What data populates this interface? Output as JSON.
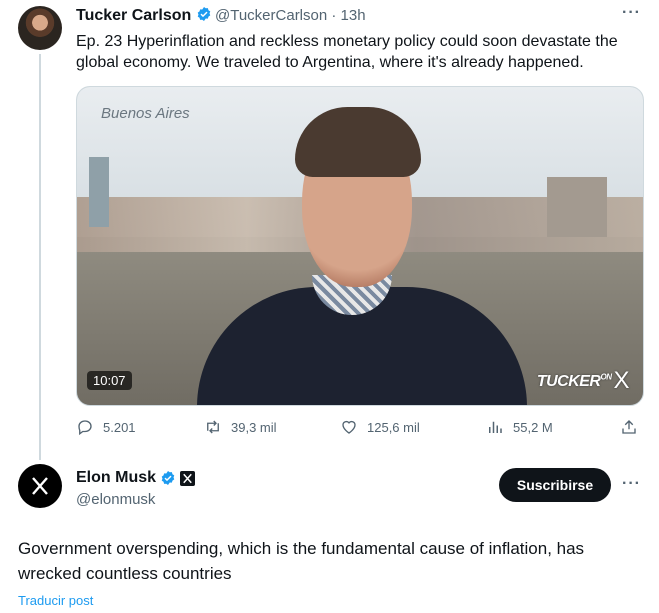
{
  "tweet": {
    "author_name": "Tucker Carlson",
    "handle": "@TuckerCarlson · 13h",
    "more": "···",
    "text": "Ep. 23  Hyperinflation and reckless monetary policy could soon devastate the global economy. We traveled to Argentina, where it's already happened.",
    "video": {
      "location_label": "Buenos Aires",
      "duration": "10:07",
      "brand": "TUCKER",
      "brand_on": "ON",
      "brand_x": "X"
    },
    "actions": {
      "replies": "5.201",
      "reposts": "39,3 mil",
      "likes": "125,6 mil",
      "views": "55,2 M"
    }
  },
  "reply": {
    "author_name": "Elon Musk",
    "handle": "@elonmusk",
    "subscribe_label": "Suscribirse",
    "more": "···",
    "text": "Government overspending, which is the fundamental cause of inflation, has wrecked countless countries",
    "translate_label": "Traducir post"
  },
  "colors": {
    "verified_blue": "#1d9bf0",
    "link_blue": "#1d9bf0",
    "muted": "#536471"
  }
}
